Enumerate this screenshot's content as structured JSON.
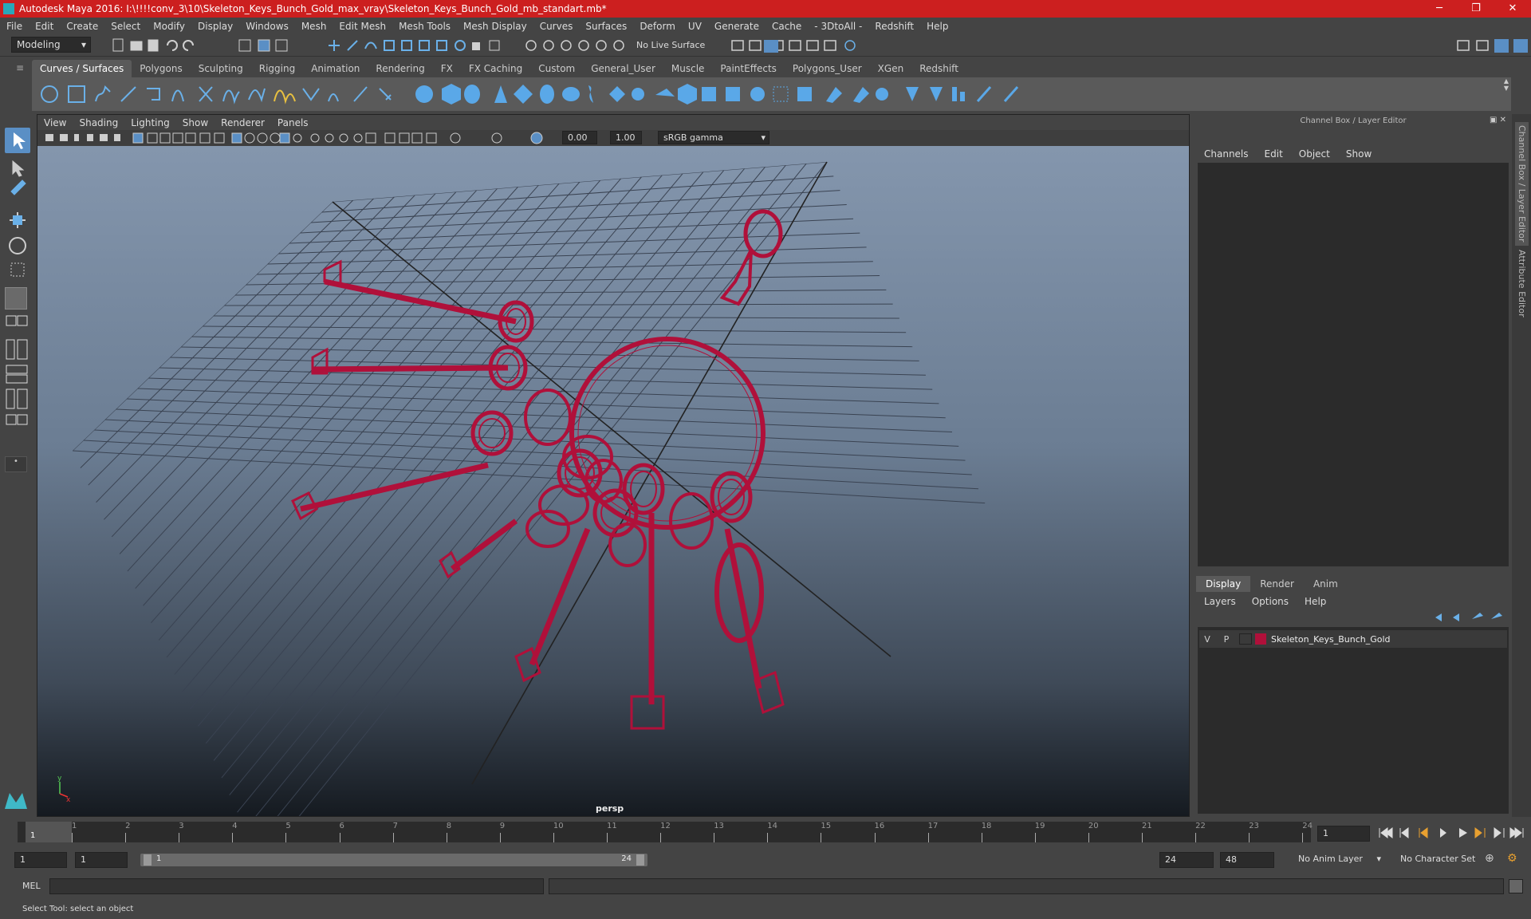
{
  "window": {
    "title": "Autodesk Maya 2016: I:\\!!!!conv_3\\10\\Skeleton_Keys_Bunch_Gold_max_vray\\Skeleton_Keys_Bunch_Gold_mb_standart.mb*",
    "minimize": "─",
    "maximize": "❐",
    "close": "✕"
  },
  "menubar": [
    "File",
    "Edit",
    "Create",
    "Select",
    "Modify",
    "Display",
    "Windows",
    "Mesh",
    "Edit Mesh",
    "Mesh Tools",
    "Mesh Display",
    "Curves",
    "Surfaces",
    "Deform",
    "UV",
    "Generate",
    "Cache",
    "- 3DtoAll -",
    "Redshift",
    "Help"
  ],
  "statusline": {
    "mode": "Modeling",
    "live_surface": "No Live Surface"
  },
  "shelf_tabs": [
    "Curves / Surfaces",
    "Polygons",
    "Sculpting",
    "Rigging",
    "Animation",
    "Rendering",
    "FX",
    "FX Caching",
    "Custom",
    "General_User",
    "Muscle",
    "PaintEffects",
    "Polygons_User",
    "XGen",
    "Redshift"
  ],
  "shelf_active": "Curves / Surfaces",
  "viewport": {
    "menu": [
      "View",
      "Shading",
      "Lighting",
      "Show",
      "Renderer",
      "Panels"
    ],
    "exposure": "0.00",
    "gamma": "1.00",
    "color_space": "sRGB gamma",
    "camera_label": "persp",
    "wire_color": "#b0103a"
  },
  "channel_box": {
    "header": "Channel Box / Layer Editor",
    "menu": [
      "Channels",
      "Edit",
      "Object",
      "Show"
    ]
  },
  "layer_editor": {
    "tabs": [
      "Display",
      "Render",
      "Anim"
    ],
    "active_tab": "Display",
    "menu": [
      "Layers",
      "Options",
      "Help"
    ],
    "layers": [
      {
        "v": "V",
        "p": "P",
        "name": "Skeleton_Keys_Bunch_Gold",
        "color": "#b0103a"
      }
    ]
  },
  "side_tabs": [
    "Channel Box / Layer Editor",
    "Attribute Editor"
  ],
  "timeslider": {
    "ticks": [
      "1",
      "2",
      "3",
      "4",
      "5",
      "6",
      "7",
      "8",
      "9",
      "10",
      "11",
      "12",
      "13",
      "14",
      "15",
      "16",
      "17",
      "18",
      "19",
      "20",
      "21",
      "22",
      "23",
      "24"
    ],
    "current_frame": "1",
    "current_field": "1"
  },
  "range": {
    "start": "1",
    "playback_start": "1",
    "slider_start": "1",
    "slider_end": "24",
    "playback_end": "24",
    "end": "48",
    "anim_layer": "No Anim Layer",
    "character_set": "No Character Set"
  },
  "cmdline": {
    "lang": "MEL"
  },
  "helpline": "Select Tool: select an object"
}
